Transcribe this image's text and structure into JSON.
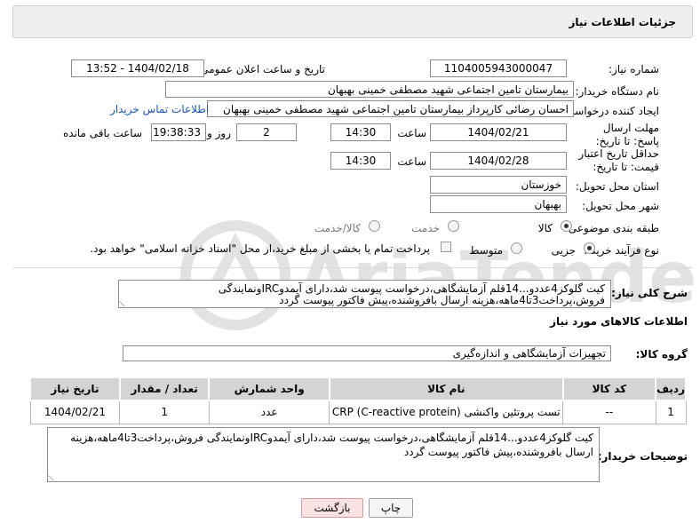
{
  "header": {
    "title": "جزئیات اطلاعات نیاز"
  },
  "labels": {
    "need_number": "شماره نیاز:",
    "announce_datetime": "تاریخ و ساعت اعلان عمومی:",
    "buyer_org": "نام دستگاه خریدار:",
    "requester": "ایجاد کننده درخواست:",
    "reply_deadline": "مهلت ارسال پاسخ: تا تاریخ:",
    "price_validity": "حداقل تاریخ اعتبار قیمت: تا تاریخ:",
    "delivery_province": "استان محل تحویل:",
    "delivery_city": "شهر محل تحویل:",
    "category": "طبقه بندی موضوعی:",
    "purchase_process": "نوع فرآیند خرید :",
    "time": "ساعت",
    "day_and": "روز و",
    "remaining": "ساعت باقی مانده"
  },
  "values": {
    "need_number": "1104005943000047",
    "announce_datetime": "1404/02/18 - 13:52",
    "buyer_org": "بیمارستان تامین اجتماعی شهید مصطفی خمینی بهبهان",
    "requester": "احسان رضائی کارپرداز بیمارستان تامین اجتماعی شهید مصطفی خمینی بهبهان",
    "contact_link": "اطلاعات تماس خریدار",
    "reply_date": "1404/02/21",
    "reply_time": "14:30",
    "reply_days": "2",
    "reply_remaining": "19:38:33",
    "validity_date": "1404/02/28",
    "validity_time": "14:30",
    "province": "خوزستان",
    "city": "بهبهان"
  },
  "category_options": {
    "goods": "کالا",
    "service": "خدمت",
    "goods_service": "کالا/خدمت",
    "selected": "کالا"
  },
  "process_options": {
    "partial": "جزیی",
    "medium": "متوسط",
    "selected": "جزیی",
    "treasury_note": "پرداخت تمام یا بخشی از مبلغ خرید،از محل \"اسناد خزانه اسلامی\" خواهد بود."
  },
  "description": {
    "label": "شرح کلی نیاز:",
    "text": "کیت گلوکز4عددو...14قلم آزمایشگاهی،درخواست پیوست شد،دارای آیمدوIRCونمایندگی فروش،پرداخت3تا4ماهه،هزینه ارسال بافروشنده،پیش فاکتور پیوست گردد"
  },
  "goods_info": {
    "title": "اطلاعات کالاهای مورد نیاز",
    "group_label": "گروه کالا:",
    "group_value": "تجهیزات آزمایشگاهی و اندازه‌گیری"
  },
  "table": {
    "headers": [
      "ردیف",
      "کد کالا",
      "نام کالا",
      "واحد شمارش",
      "تعداد / مقدار",
      "تاریخ نیاز"
    ],
    "rows": [
      [
        "1",
        "--",
        "تست پروتئین واکنشی (CRP (C-reactive protein",
        "عدد",
        "1",
        "1404/02/21"
      ]
    ]
  },
  "buyer_notes": {
    "label": "توضیحات خریدار:",
    "text": "کیت گلوکز4عددو...14قلم آزمایشگاهی،درخواست پیوست شد،دارای آیمدوIRCونمایندگی فروش،پرداخت3تا4ماهه،هزینه ارسال بافروشنده،پیش فاکتور پیوست گردد"
  },
  "buttons": {
    "print": "چاپ",
    "back": "بازگشت"
  },
  "watermark": {
    "text": "AriaTender.net"
  },
  "colors": {
    "link": "#1a57b3",
    "back_button_bg": "#fbe3e3",
    "back_button_border": "#d79b9b",
    "header_bg": "#efefef"
  }
}
